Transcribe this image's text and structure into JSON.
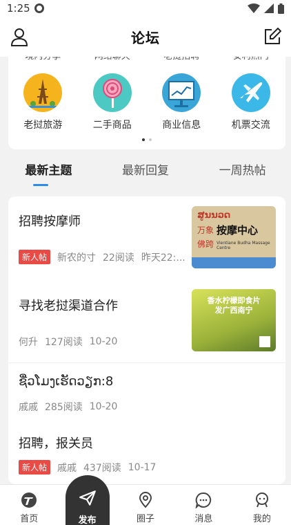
{
  "status": {
    "time": "1:25"
  },
  "header": {
    "title": "论坛"
  },
  "categories_partial": [
    "境内分享",
    "网络聊天",
    "老挝招聘",
    "安利热门"
  ],
  "categories": [
    {
      "label": "老挝旅游",
      "icon": "eiffel-tower-icon",
      "color": "#f5b41e"
    },
    {
      "label": "二手商品",
      "icon": "lollipop-icon",
      "color": "#4cc9c2"
    },
    {
      "label": "商业信息",
      "icon": "chart-board-icon",
      "color": "#3aa6d8"
    },
    {
      "label": "机票交流",
      "icon": "airplane-icon",
      "color": "#3bb8e8"
    }
  ],
  "tabs": [
    {
      "label": "最新主题",
      "active": true
    },
    {
      "label": "最新回复",
      "active": false
    },
    {
      "label": "一周热帖",
      "active": false
    }
  ],
  "posts": [
    {
      "title": "招聘按摩师",
      "badge": "新人帖",
      "author": "新农的寸",
      "reads": "22阅读",
      "time": "昨天22:..."
    },
    {
      "title": "寻找老挝渠道合作",
      "badge": "",
      "author": "何升",
      "reads": "127阅读",
      "time": "10-20"
    },
    {
      "title": "ຊື່ວໂມງເຮັດວຽກ:8",
      "badge": "",
      "author": "戚戚",
      "reads": "285阅读",
      "time": "10-20"
    },
    {
      "title": "招聘，报关员",
      "badge": "新人帖",
      "author": "戚戚",
      "reads": "437阅读",
      "time": "10-17"
    }
  ],
  "thumb1": {
    "line1": "ສູນນວດ",
    "line2a": "万象",
    "line2b": "按摩中心",
    "line3": "佛跨",
    "line4": "Vientiane Budha Massage Centre"
  },
  "thumb2": {
    "line1": "香水柠檬即食片",
    "line2": "发广西南宁"
  },
  "bottom_nav": [
    {
      "label": "首页",
      "icon": "home-logo-icon"
    },
    {
      "label": "发布",
      "icon": "send-icon"
    },
    {
      "label": "圈子",
      "icon": "location-pin-icon"
    },
    {
      "label": "消息",
      "icon": "chat-bubble-icon"
    },
    {
      "label": "我的",
      "icon": "profile-icon"
    }
  ],
  "colors": {
    "accent": "#2a8be8",
    "badge": "#e84a45",
    "publish": "#333333"
  }
}
